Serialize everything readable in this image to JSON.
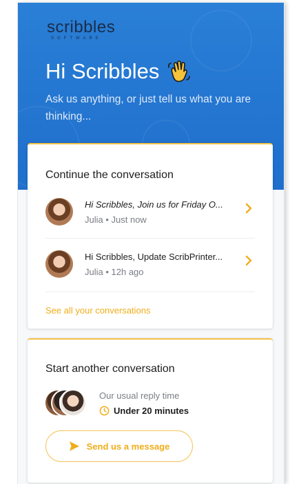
{
  "brand": {
    "logo_word": "scribbles",
    "logo_sub": "SOFTWARE"
  },
  "hero": {
    "greeting": "Hi Scribbles",
    "tagline": "Ask us anything, or just tell us what you are thinking..."
  },
  "continue_card": {
    "title": "Continue the conversation",
    "conversations": [
      {
        "message": "Hi Scribbles, Join us for Friday O...",
        "author": "Julia",
        "time": "Just now",
        "meta": "Julia • Just now"
      },
      {
        "message": "Hi Scribbles, Update ScribPrinter...",
        "author": "Julia",
        "time": "12h ago",
        "meta": "Julia • 12h ago"
      }
    ],
    "see_all": "See all your conversations"
  },
  "start_card": {
    "title": "Start another conversation",
    "reply_label": "Our usual reply time",
    "reply_time": "Under 20 minutes",
    "send_label": "Send us a message"
  },
  "colors": {
    "hero_blue": "#2a7fd6",
    "accent": "#f0ad1b"
  },
  "icons": {
    "wave": "waving-hand-icon",
    "chevron": "chevron-right-icon",
    "clock": "clock-icon",
    "send": "paper-plane-icon"
  }
}
